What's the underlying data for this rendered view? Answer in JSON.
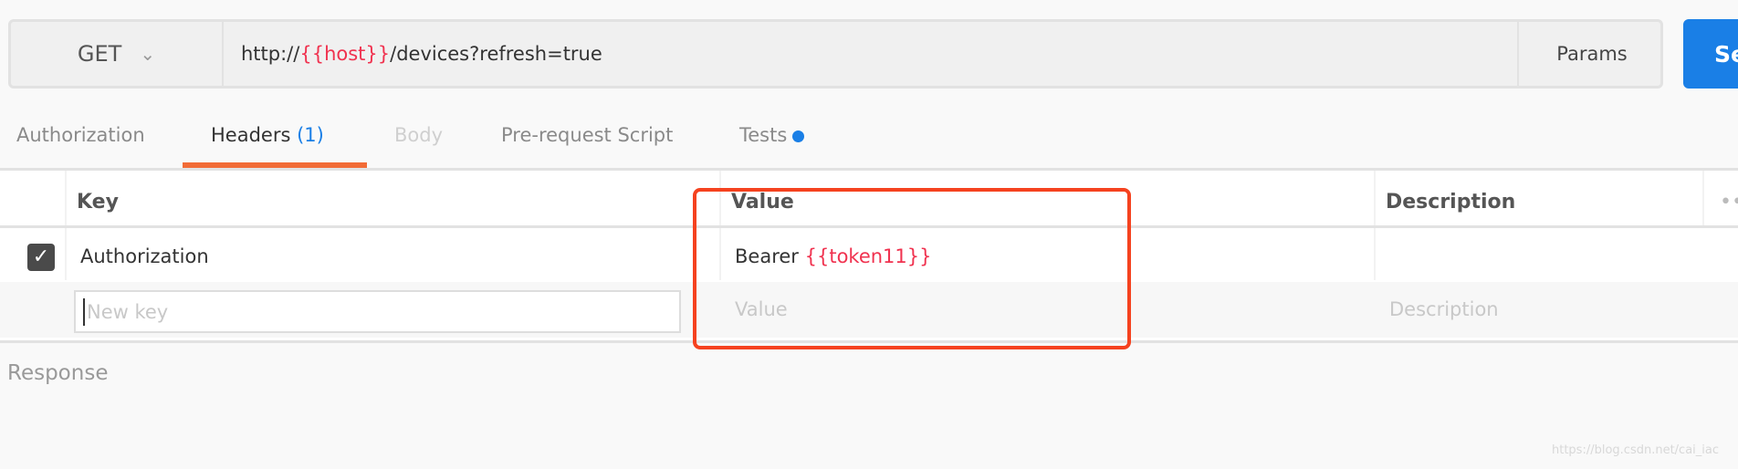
{
  "request": {
    "method": "GET",
    "url_prefix": "http://",
    "url_var": "{{host}}",
    "url_suffix": "/devices?refresh=true",
    "params_label": "Params",
    "send_label": "Se"
  },
  "tabs": [
    {
      "label": "Authorization"
    },
    {
      "label": "Headers",
      "count": "(1)"
    },
    {
      "label": "Body"
    },
    {
      "label": "Pre-request Script"
    },
    {
      "label": "Tests"
    }
  ],
  "table": {
    "headers": {
      "key": "Key",
      "value": "Value",
      "description": "Description"
    },
    "rows": [
      {
        "checked": true,
        "key": "Authorization",
        "value_prefix": "Bearer ",
        "value_var": "{{token11}}",
        "description": ""
      }
    ],
    "new_row": {
      "key_placeholder": "New key",
      "value_placeholder": "Value",
      "description_placeholder": "Description"
    }
  },
  "response_label": "Response",
  "watermark": "https://blog.csdn.net/cai_iac",
  "colors": {
    "accent": "#1a7fe6",
    "variable": "#f0324f",
    "tab_underline": "#f26b36",
    "highlight_box": "#f5421f"
  }
}
